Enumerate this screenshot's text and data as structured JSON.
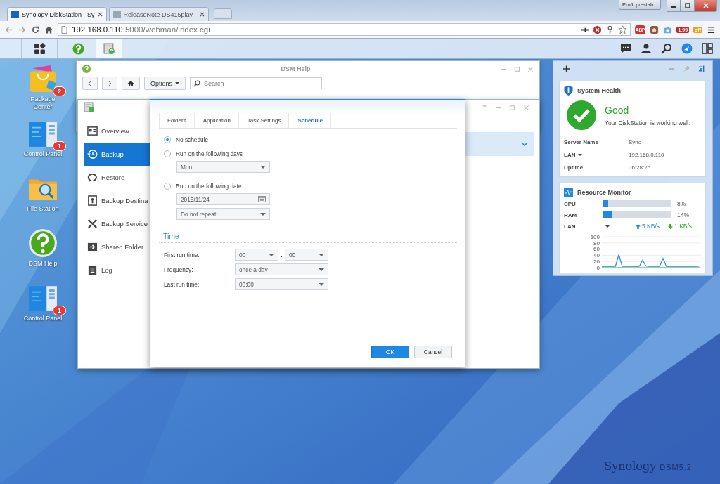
{
  "browser": {
    "tabs": [
      {
        "title": "Synology DiskStation - Sy",
        "selected": true
      },
      {
        "title": "ReleaseNote DS415play -",
        "selected": false
      }
    ],
    "profile": "Profil prestab...",
    "address": {
      "host": "192.168.0.110",
      "path": ":5000/webman/index.cgi"
    },
    "extensions": [
      {
        "kind": "adblock",
        "text": "ABP"
      },
      {
        "kind": "price",
        "text": "1.99"
      },
      {
        "kind": "robot",
        "text": "off"
      }
    ]
  },
  "desktop_icons": [
    {
      "kind": "package",
      "label": "Package Center",
      "badge": "2"
    },
    {
      "kind": "control",
      "label": "Control Panel",
      "badge": "1"
    },
    {
      "kind": "files",
      "label": "File Station"
    },
    {
      "kind": "help",
      "label": "DSM Help"
    },
    {
      "kind": "control",
      "label": "Control Panel",
      "badge": "1"
    }
  ],
  "help_window": {
    "title": "DSM Help",
    "options": "Options",
    "search": {
      "placeholder": "Search"
    }
  },
  "backup_window": {
    "sidebar": [
      {
        "label": "Overview",
        "selected": false
      },
      {
        "label": "Backup",
        "selected": true
      },
      {
        "label": "Restore",
        "selected": false
      },
      {
        "label": "Backup Destina",
        "selected": false
      },
      {
        "label": "Backup Service",
        "selected": false
      },
      {
        "label": "Shared Folder",
        "selected": false
      },
      {
        "label": "Log",
        "selected": false
      }
    ]
  },
  "dialog": {
    "tabs": [
      {
        "label": "Folders",
        "selected": false
      },
      {
        "label": "Application",
        "selected": false
      },
      {
        "label": "Task Settings",
        "selected": false
      },
      {
        "label": "Schedule",
        "selected": true
      }
    ],
    "schedule": [
      {
        "label": "No schedule",
        "selected": true
      },
      {
        "label": "Run on the following days",
        "selected": false,
        "fields": [
          {
            "kind": "select",
            "value": "Mon"
          }
        ]
      },
      {
        "label": "Run on the following date",
        "selected": false,
        "fields": [
          {
            "kind": "date",
            "value": "2015/11/24"
          },
          {
            "kind": "select",
            "value": "Do not repeat"
          }
        ]
      }
    ],
    "time_heading": "Time",
    "first_run": {
      "label": "First run time:",
      "hour": "00",
      "separator": ":",
      "minute": "00"
    },
    "frequency": {
      "label": "Frequency:",
      "value": "once a day"
    },
    "last_run": {
      "label": "Last run time:",
      "value": "00:00"
    },
    "buttons": [
      "OK",
      "Cancel"
    ]
  },
  "widgets": {
    "system_health": {
      "title": "System Health",
      "status": "Good",
      "message": "Your DiskStation is working well.",
      "rows": [
        {
          "label": "Server Name",
          "value": "Syno",
          "dropdown": false
        },
        {
          "label": "LAN",
          "value": "192.168.0.110",
          "dropdown": true
        },
        {
          "label": "Uptime",
          "value": "06:28:25",
          "dropdown": false
        }
      ]
    },
    "resource_monitor": {
      "title": "Resource Monitor",
      "meters": [
        {
          "label": "CPU",
          "level": 0.08,
          "reading": "8%"
        },
        {
          "label": "RAM",
          "level": 0.14,
          "reading": "14%"
        }
      ],
      "lan": {
        "label": "LAN",
        "upload": "5 KB/s",
        "download": "1 KB/s"
      },
      "chart_data": {
        "type": "line",
        "ylim": [
          0,
          100
        ],
        "yticks": [
          0,
          20,
          40,
          60,
          80,
          100
        ],
        "grid": true,
        "series": [
          {
            "color": "#2eb82e",
            "values": [
              0,
              0,
              0,
              0,
              0,
              0,
              0,
              0,
              0,
              0,
              0,
              0,
              0,
              0,
              0,
              0,
              0,
              0,
              0,
              0,
              0,
              0,
              0,
              0,
              0,
              0,
              0,
              0,
              0,
              0
            ]
          },
          {
            "color": "#1e88e5",
            "values": [
              4,
              4,
              4,
              4,
              4,
              42,
              4,
              4,
              4,
              4,
              4,
              4,
              24,
              5,
              4,
              4,
              4,
              4,
              30,
              4,
              4,
              4,
              4,
              4,
              4,
              4,
              4,
              4,
              4,
              6
            ]
          }
        ]
      }
    }
  },
  "branding": {
    "name": "Synology",
    "version": "DSM5.2"
  }
}
